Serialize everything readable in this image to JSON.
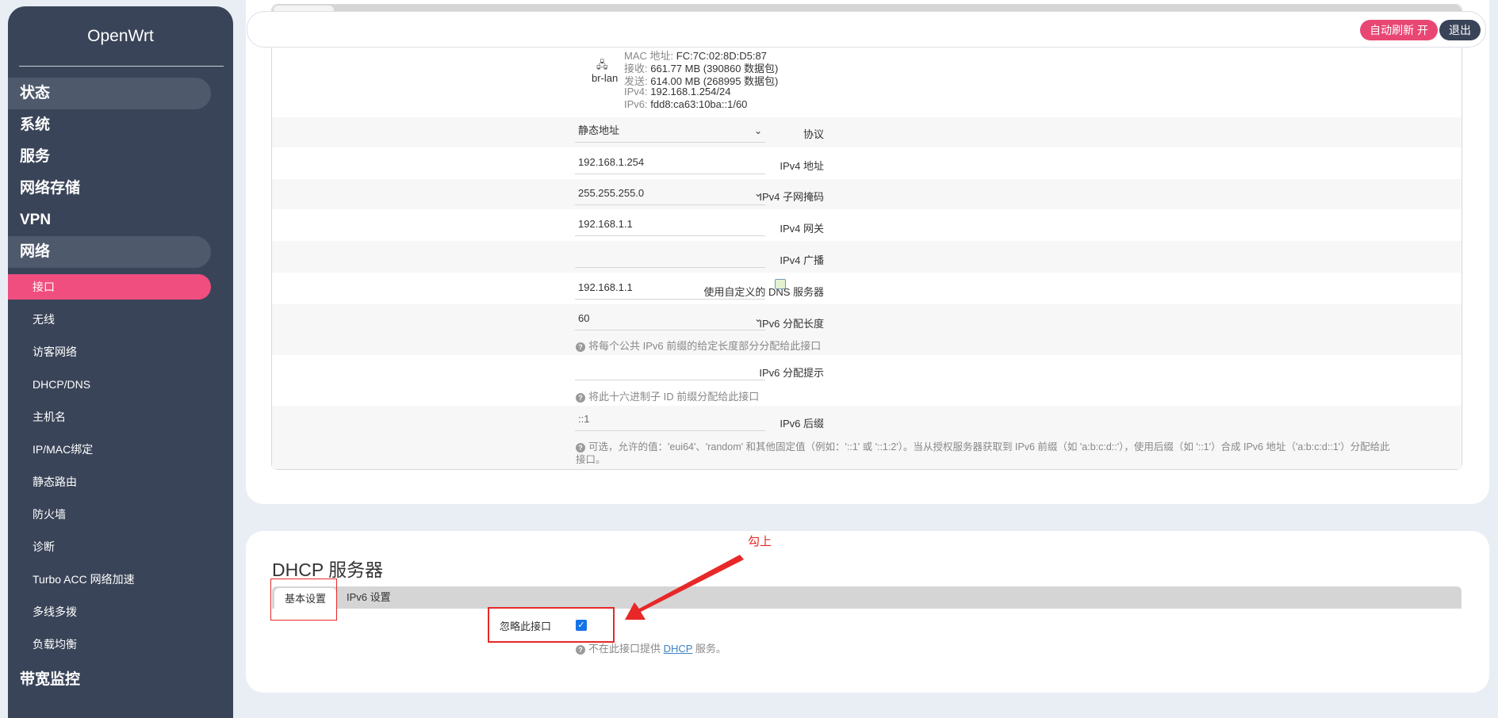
{
  "sidebar": {
    "brand": "OpenWrt",
    "top_items": [
      {
        "label": "状态"
      },
      {
        "label": "系统"
      },
      {
        "label": "服务"
      },
      {
        "label": "网络存储"
      },
      {
        "label": "VPN"
      },
      {
        "label": "网络"
      }
    ],
    "sub_items": [
      {
        "label": "接口"
      },
      {
        "label": "无线"
      },
      {
        "label": "访客网络"
      },
      {
        "label": "DHCP/DNS"
      },
      {
        "label": "主机名"
      },
      {
        "label": "IP/MAC绑定"
      },
      {
        "label": "静态路由"
      },
      {
        "label": "防火墙"
      },
      {
        "label": "诊断"
      },
      {
        "label": "Turbo ACC 网络加速"
      },
      {
        "label": "多线多拨"
      },
      {
        "label": "负载均衡"
      }
    ],
    "bottom_item": "带宽监控"
  },
  "topbar": {
    "refresh_label": "自动刷新 开",
    "logout_label": "退出"
  },
  "device": {
    "name": "br-lan",
    "mac_key": "MAC 地址:",
    "mac": "FC:7C:02:8D:D5:87",
    "rx_key": "接收:",
    "rx": "661.77 MB (390860 数据包)",
    "tx_key": "发送:",
    "tx": "614.00 MB (268995 数据包)",
    "ipv4_key": "IPv4:",
    "ipv4": "192.168.1.254/24",
    "ipv6_key": "IPv6:",
    "ipv6": "fdd8:ca63:10ba::1/60"
  },
  "form": {
    "protocol_label": "协议",
    "protocol_value": "静态地址",
    "ipv4_addr_label": "IPv4 地址",
    "ipv4_addr_value": "192.168.1.254",
    "ipv4_mask_label": "IPv4 子网掩码",
    "ipv4_mask_value": "255.255.255.0",
    "ipv4_gw_label": "IPv4 网关",
    "ipv4_gw_value": "192.168.1.1",
    "ipv4_bcast_label": "IPv4 广播",
    "ipv4_bcast_value": "",
    "dns_label": "使用自定义的 DNS 服务器",
    "dns_value": "192.168.1.1",
    "ipv6_len_label": "IPv6 分配长度",
    "ipv6_len_value": "60",
    "ipv6_len_help": "将每个公共 IPv6 前缀的给定长度部分分配给此接口",
    "ipv6_hint_label": "IPv6 分配提示",
    "ipv6_hint_value": "",
    "ipv6_hint_help": "将此十六进制子 ID 前缀分配给此接口",
    "ipv6_suffix_label": "IPv6 后缀",
    "ipv6_suffix_value": "::1",
    "ipv6_suffix_help_1": "可选，允许的值：'eui64'、'random' 和其他固定值（例如：'::1' 或 '::1:2'）。当从授权服务器获取到 IPv6 前缀（如 'a:b:c:d::'），使用后缀（如 '::1'）合成 IPv6 地址（'a:b:c:d::1'）分配给此",
    "ipv6_suffix_help_2": "接口。"
  },
  "dhcp": {
    "title": "DHCP 服务器",
    "tab_basic": "基本设置",
    "tab_ipv6": "IPv6 设置",
    "ignore_label": "忽略此接口",
    "ignore_checked": true,
    "help_pre": "不在此接口提供 ",
    "help_link": "DHCP",
    "help_post": " 服务。"
  },
  "annotation": {
    "text": "勾上",
    "color": "#e82828"
  },
  "colors": {
    "accent": "#f04e7f",
    "sidebar_bg": "#3a4458"
  }
}
